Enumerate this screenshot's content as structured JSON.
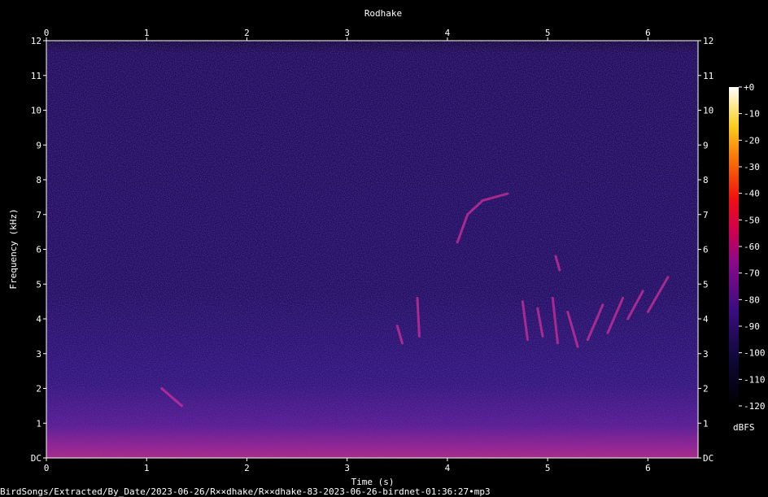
{
  "chart_data": {
    "type": "heatmap",
    "title": "Rodhake",
    "xlabel": "Time (s)",
    "ylabel": "Frequency (kHz)",
    "xlim": [
      0,
      6.5
    ],
    "ylim": [
      0,
      12
    ],
    "x_ticks": [
      "0",
      "1",
      "2",
      "3",
      "4",
      "5",
      "6"
    ],
    "y_ticks": [
      "DC",
      "1",
      "2",
      "3",
      "4",
      "5",
      "6",
      "7",
      "8",
      "9",
      "10",
      "11",
      "12"
    ],
    "colorbar": {
      "label": "dBFS",
      "ticks": [
        "+0",
        "-10",
        "-20",
        "-30",
        "-40",
        "-50",
        "-60",
        "-70",
        "-80",
        "-90",
        "-100",
        "-110",
        "-120"
      ],
      "range": [
        -120,
        0
      ]
    },
    "colors": {
      "background": "#000000",
      "noise": "#1e0f5a",
      "signal": "#d0309a"
    }
  },
  "footer": {
    "file_path": "BirdSongs/Extracted/By_Date/2023-06-26/R××dhake/R××dhake-83-2023-06-26-birdnet-01:36:27•mp3"
  }
}
